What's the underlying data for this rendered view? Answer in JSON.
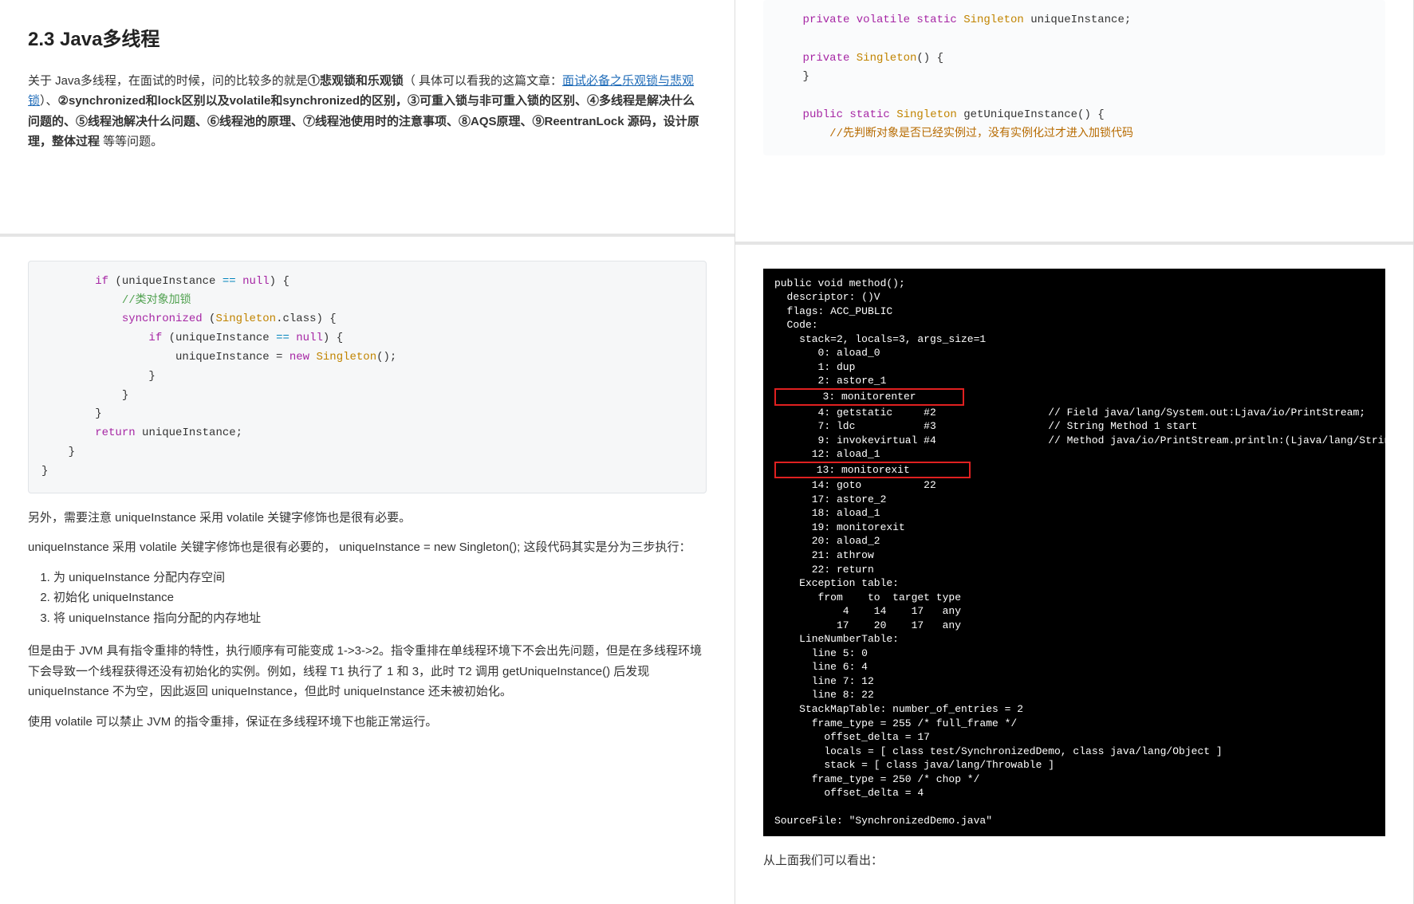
{
  "left": {
    "heading": "2.3 Java多线程",
    "intro_prefix": "关于 Java多线程，在面试的时候，问的比较多的就是",
    "bold1": "①悲观锁和乐观锁",
    "paren_open": "（ 具体可以看我的这篇文章：",
    "link": "面试必备之乐观锁与悲观锁",
    "paren_close": "）、",
    "bold2": "②synchronized和lock区别以及volatile和synchronized的区别，③可重入锁与非可重入锁的区别、④多线程是解决什么问题的、⑤线程池解决什么问题、⑥线程池的原理、⑦线程池使用时的注意事项、⑧AQS原理、⑨ReentranLock 源码，设计原理，整体过程",
    "after_bold": " 等等问题。",
    "code1": {
      "raw": "        if (uniqueInstance == null) {\n            //类对象加锁\n            synchronized (Singleton.class) {\n                if (uniqueInstance == null) {\n                    uniqueInstance = new Singleton();\n                }\n            }\n        }\n        return uniqueInstance;\n    }\n}"
    },
    "para1": "另外，需要注意 uniqueInstance 采用 volatile 关键字修饰也是很有必要。",
    "para2": "uniqueInstance 采用 volatile 关键字修饰也是很有必要的， uniqueInstance = new Singleton(); 这段代码其实是分为三步执行：",
    "list": [
      "为 uniqueInstance 分配内存空间",
      "初始化 uniqueInstance",
      "将 uniqueInstance 指向分配的内存地址"
    ],
    "para3": "但是由于 JVM 具有指令重排的特性，执行顺序有可能变成 1->3->2。指令重排在单线程环境下不会出先问题，但是在多线程环境下会导致一个线程获得还没有初始化的实例。例如，线程 T1 执行了 1 和 3，此时 T2 调用 getUniqueInstance() 后发现 uniqueInstance 不为空，因此返回 uniqueInstance，但此时 uniqueInstance 还未被初始化。",
    "para4": "使用 volatile 可以禁止 JVM 的指令重排，保证在多线程环境下也能正常运行。"
  },
  "right": {
    "code_top": {
      "line1_a": "    private volatile static ",
      "line1_b": "Singleton",
      "line1_c": " uniqueInstance;",
      "line3_a": "    private ",
      "line3_b": "Singleton",
      "line3_c": "() {",
      "line4": "    }",
      "line6_a": "    public static ",
      "line6_b": "Singleton",
      "line6_c": " getUniqueInstance() {",
      "line7_cmt": "        //先判断对象是否已经实例过，没有实例化过才进入加锁代码"
    },
    "bytecode": "public void method();\n  descriptor: ()V\n  flags: ACC_PUBLIC\n  Code:\n    stack=2, locals=3, args_size=1\n       0: aload_0\n       1: dup\n       2: astore_1\n       3: monitorenter\n       4: getstatic     #2                  // Field java/lang/System.out:Ljava/io/PrintStream;\n       7: ldc           #3                  // String Method 1 start\n       9: invokevirtual #4                  // Method java/io/PrintStream.println:(Ljava/lang/String;)V\n      12: aload_1\n      13: monitorexit\n      14: goto          22\n      17: astore_2\n      18: aload_1\n      19: monitorexit\n      20: aload_2\n      21: athrow\n      22: return\n    Exception table:\n       from    to  target type\n           4    14    17   any\n          17    20    17   any\n    LineNumberTable:\n      line 5: 0\n      line 6: 4\n      line 7: 12\n      line 8: 22\n    StackMapTable: number_of_entries = 2\n      frame_type = 255 /* full_frame */\n        offset_delta = 17\n        locals = [ class test/SynchronizedDemo, class java/lang/Object ]\n        stack = [ class java/lang/Throwable ]\n      frame_type = 250 /* chop */\n        offset_delta = 4\n\nSourceFile: \"SynchronizedDemo.java\"",
    "after_bytecode": "从上面我们可以看出："
  }
}
